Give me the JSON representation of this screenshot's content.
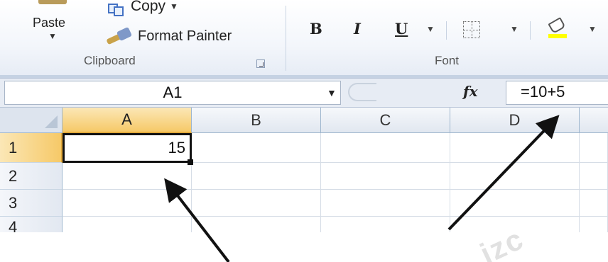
{
  "ribbon": {
    "clipboard": {
      "paste_label": "Paste",
      "copy_label": "Copy",
      "format_painter_label": "Format Painter",
      "group_label": "Clipboard"
    },
    "font": {
      "group_label": "Font",
      "bold_label": "B",
      "italic_label": "I",
      "underline_label": "U",
      "fill_color": "#ffff00"
    }
  },
  "formula_bar": {
    "name_box_value": "A1",
    "fx_label": "fx",
    "formula_value": "=10+5"
  },
  "sheet": {
    "columns": [
      "A",
      "B",
      "C",
      "D"
    ],
    "rows": [
      "1",
      "2",
      "3",
      "4"
    ],
    "active_cell": "A1",
    "active_cell_value": "15"
  },
  "annotations": {
    "watermark_text": "izc",
    "arrow_color": "#111111"
  }
}
